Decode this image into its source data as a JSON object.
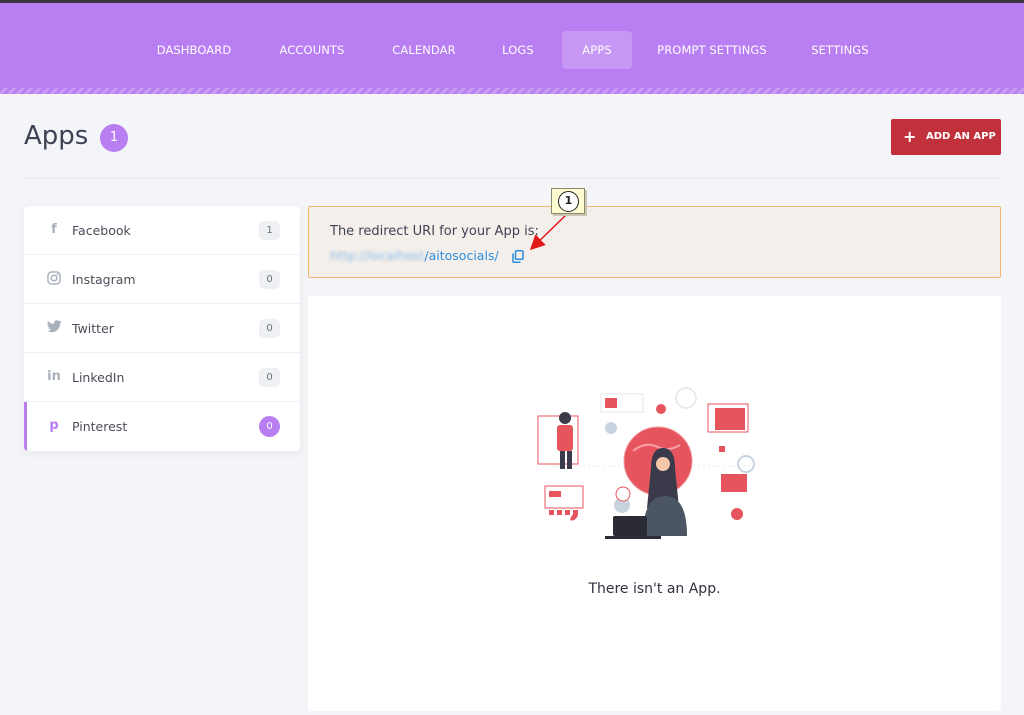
{
  "nav": {
    "items": [
      {
        "label": "DASHBOARD",
        "active": false
      },
      {
        "label": "ACCOUNTS",
        "active": false
      },
      {
        "label": "CALENDAR",
        "active": false
      },
      {
        "label": "LOGS",
        "active": false
      },
      {
        "label": "APPS",
        "active": true
      },
      {
        "label": "PROMPT SETTINGS",
        "active": false
      },
      {
        "label": "SETTINGS",
        "active": false
      }
    ],
    "color": "#b87ef2"
  },
  "header": {
    "title": "Apps",
    "count": "1",
    "add_button_icon": "+",
    "add_button_label": "ADD AN APP",
    "add_button_color": "#c1313b"
  },
  "sidebar": {
    "items": [
      {
        "label": "Facebook",
        "count": "1",
        "icon": "facebook-icon",
        "glyph": "f"
      },
      {
        "label": "Instagram",
        "count": "0",
        "icon": "instagram-icon",
        "glyph": ""
      },
      {
        "label": "Twitter",
        "count": "0",
        "icon": "twitter-icon",
        "glyph": ""
      },
      {
        "label": "LinkedIn",
        "count": "0",
        "icon": "linkedin-icon",
        "glyph": "in"
      },
      {
        "label": "Pinterest",
        "count": "0",
        "icon": "pinterest-icon",
        "glyph": "p",
        "active": true
      }
    ]
  },
  "notice": {
    "title": "The redirect URI for your App is:",
    "url_blurred": "http://localhost",
    "url_path": "/aitosocials/"
  },
  "annotation": {
    "number": "1"
  },
  "empty_state": {
    "message": "There isn't an App."
  }
}
